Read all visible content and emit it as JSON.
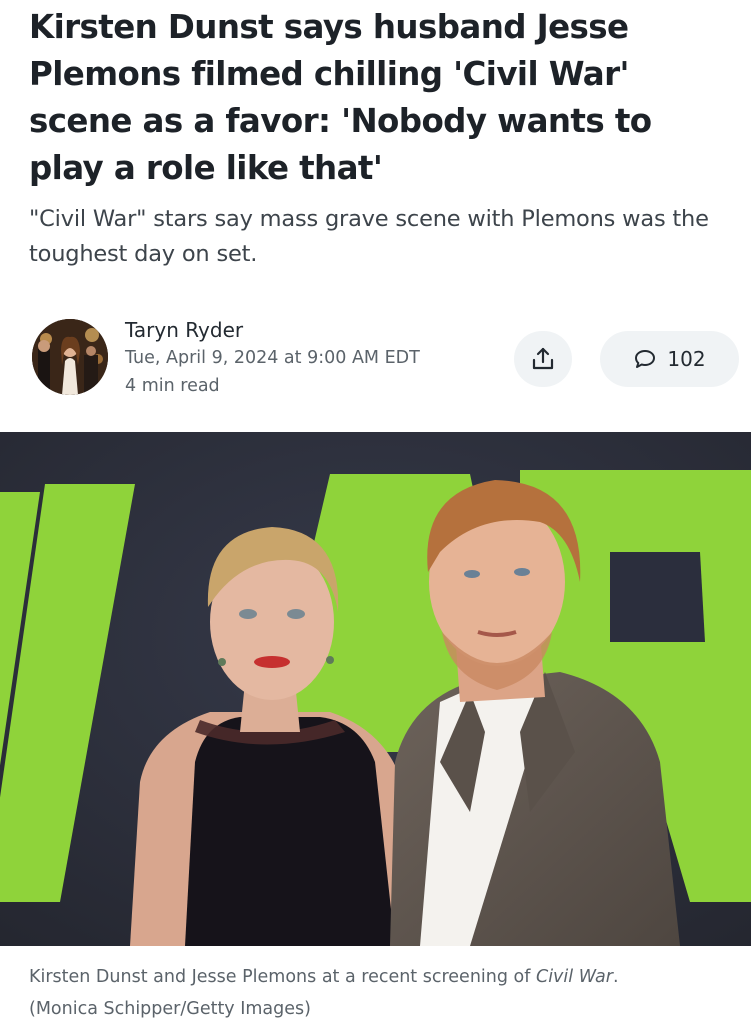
{
  "article": {
    "headline": "Kirsten Dunst says husband Jesse Plemons filmed chilling 'Civil War' scene as a favor: 'Nobody wants to play a role like that'",
    "subhead": "\"Civil War\" stars say mass grave scene with Plemons was the toughest day on set."
  },
  "byline": {
    "author": "Taryn Ryder",
    "date": "Tue, April 9, 2024 at 9:00 AM EDT",
    "read_time": "4 min read"
  },
  "actions": {
    "share_icon": "share-icon",
    "comment_icon": "comment-icon",
    "comment_count": "102"
  },
  "hero": {
    "caption_prefix": "Kirsten Dunst and Jesse Plemons at a recent screening of ",
    "caption_title": "Civil War",
    "caption_suffix": ".",
    "credit": "(Monica Schipper/Getty Images)"
  },
  "colors": {
    "backdrop_green": "#8fd33a",
    "backdrop_dark": "#2b2e3d",
    "button_bg": "#f0f3f5"
  }
}
